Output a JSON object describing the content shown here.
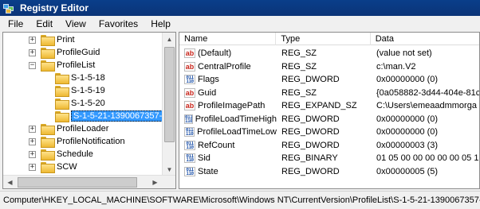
{
  "window": {
    "title": "Registry Editor"
  },
  "menu": [
    "File",
    "Edit",
    "View",
    "Favorites",
    "Help"
  ],
  "tree": [
    {
      "label": "Print",
      "expander": "+",
      "level": 0
    },
    {
      "label": "ProfileGuid",
      "expander": "+",
      "level": 0
    },
    {
      "label": "ProfileList",
      "expander": "−",
      "level": 0
    },
    {
      "label": "S-1-5-18",
      "expander": "",
      "level": 1
    },
    {
      "label": "S-1-5-19",
      "expander": "",
      "level": 1
    },
    {
      "label": "S-1-5-20",
      "expander": "",
      "level": 1
    },
    {
      "label": "S-1-5-21-1390067357-",
      "expander": "",
      "level": 1,
      "selected": true
    },
    {
      "label": "ProfileLoader",
      "expander": "+",
      "level": 0
    },
    {
      "label": "ProfileNotification",
      "expander": "+",
      "level": 0
    },
    {
      "label": "Schedule",
      "expander": "+",
      "level": 0
    },
    {
      "label": "SCW",
      "expander": "+",
      "level": 0
    }
  ],
  "columns": [
    "Name",
    "Type",
    "Data"
  ],
  "values": [
    {
      "icon": "string-value-icon",
      "name": "(Default)",
      "type": "REG_SZ",
      "data": "(value not set)"
    },
    {
      "icon": "string-value-icon",
      "name": "CentralProfile",
      "type": "REG_SZ",
      "data": "c:\\man.V2"
    },
    {
      "icon": "binary-value-icon",
      "name": "Flags",
      "type": "REG_DWORD",
      "data": "0x00000000 (0)"
    },
    {
      "icon": "string-value-icon",
      "name": "Guid",
      "type": "REG_SZ",
      "data": "{0a058882-3d44-404e-81c"
    },
    {
      "icon": "string-value-icon",
      "name": "ProfileImagePath",
      "type": "REG_EXPAND_SZ",
      "data": "C:\\Users\\emeaadmmorga"
    },
    {
      "icon": "binary-value-icon",
      "name": "ProfileLoadTimeHigh",
      "type": "REG_DWORD",
      "data": "0x00000000 (0)"
    },
    {
      "icon": "binary-value-icon",
      "name": "ProfileLoadTimeLow",
      "type": "REG_DWORD",
      "data": "0x00000000 (0)"
    },
    {
      "icon": "binary-value-icon",
      "name": "RefCount",
      "type": "REG_DWORD",
      "data": "0x00000003 (3)"
    },
    {
      "icon": "binary-value-icon",
      "name": "Sid",
      "type": "REG_BINARY",
      "data": "01 05 00 00 00 00 00 05 15"
    },
    {
      "icon": "binary-value-icon",
      "name": "State",
      "type": "REG_DWORD",
      "data": "0x00000005 (5)"
    }
  ],
  "status": "Computer\\HKEY_LOCAL_MACHINE\\SOFTWARE\\Microsoft\\Windows NT\\CurrentVersion\\ProfileList\\S-1-5-21-1390067357-145",
  "icons": {
    "ab": "ab",
    "bin": "011\n110"
  }
}
